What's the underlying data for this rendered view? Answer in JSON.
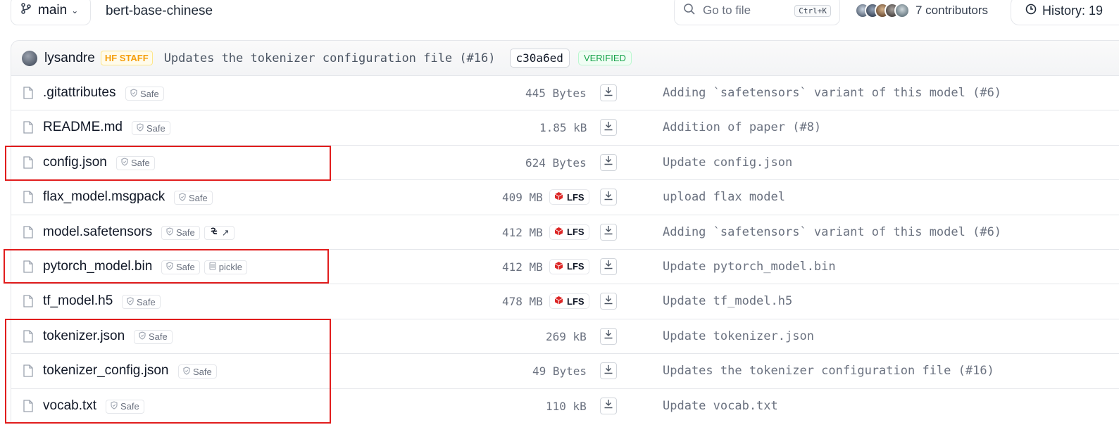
{
  "header": {
    "branch": "main",
    "repo": "bert-base-chinese",
    "search_placeholder": "Go to file",
    "search_shortcut": "Ctrl+K",
    "contributors_label": "7 contributors",
    "history_label": "History: 19"
  },
  "commit": {
    "user": "lysandre",
    "badge": "HF STAFF",
    "message": "Updates the tokenizer configuration file (#16)",
    "hash": "c30a6ed",
    "verified": "VERIFIED"
  },
  "files": [
    {
      "name": ".gitattributes",
      "safe": "Safe",
      "size": "445 Bytes",
      "lfs": "",
      "extra": "",
      "message": "Adding `safetensors` variant of this model (#6)"
    },
    {
      "name": "README.md",
      "safe": "Safe",
      "size": "1.85 kB",
      "lfs": "",
      "extra": "",
      "message": "Addition of paper (#8)"
    },
    {
      "name": "config.json",
      "safe": "Safe",
      "size": "624 Bytes",
      "lfs": "",
      "extra": "",
      "message": "Update config.json"
    },
    {
      "name": "flax_model.msgpack",
      "safe": "Safe",
      "size": "409 MB",
      "lfs": "LFS",
      "extra": "",
      "message": "upload flax model"
    },
    {
      "name": "model.safetensors",
      "safe": "Safe",
      "size": "412 MB",
      "lfs": "LFS",
      "extra": "safetensors",
      "message": "Adding `safetensors` variant of this model (#6)"
    },
    {
      "name": "pytorch_model.bin",
      "safe": "Safe",
      "size": "412 MB",
      "lfs": "LFS",
      "extra": "pickle",
      "message": "Update pytorch_model.bin"
    },
    {
      "name": "tf_model.h5",
      "safe": "Safe",
      "size": "478 MB",
      "lfs": "LFS",
      "extra": "",
      "message": "Update tf_model.h5"
    },
    {
      "name": "tokenizer.json",
      "safe": "Safe",
      "size": "269 kB",
      "lfs": "",
      "extra": "",
      "message": "Update tokenizer.json"
    },
    {
      "name": "tokenizer_config.json",
      "safe": "Safe",
      "size": "49 Bytes",
      "lfs": "",
      "extra": "",
      "message": "Updates the tokenizer configuration file (#16)"
    },
    {
      "name": "vocab.txt",
      "safe": "Safe",
      "size": "110 kB",
      "lfs": "",
      "extra": "",
      "message": "Update vocab.txt"
    }
  ],
  "colors": {
    "highlight": "#e11d1d",
    "lfs": "#dc2626",
    "verified": "#16a34a",
    "staff": "#f59e0b"
  }
}
